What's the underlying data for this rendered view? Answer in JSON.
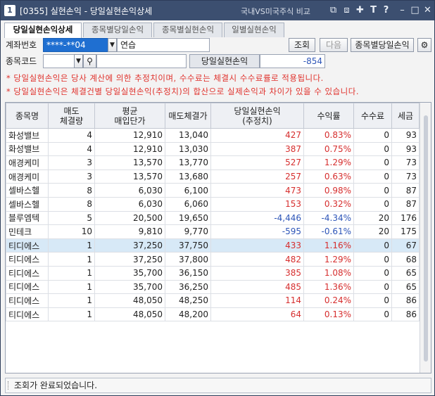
{
  "window": {
    "number": "1",
    "title": "[0355]  실현손익 - 당일실현손익상세",
    "right_text": "국내VS미국주식 비교",
    "icons": [
      "screen-number-icon",
      "window-copy-icon",
      "pin-icon",
      "text-size-icon",
      "help-icon",
      "minimize-icon",
      "maximize-icon",
      "close-icon"
    ]
  },
  "tabs": [
    {
      "label": "당일실현손익상세",
      "active": true
    },
    {
      "label": "종목별당일손익",
      "active": false
    },
    {
      "label": "종목별실현손익",
      "active": false
    },
    {
      "label": "일별실현손익",
      "active": false
    }
  ],
  "form": {
    "account_label": "계좌번호",
    "account_value": "****-**04",
    "account_name": "연습",
    "query_button": "조회",
    "next_button": "다음",
    "by_stock_button": "종목별당일손익",
    "stock_code_label": "종목코드",
    "stock_code_value": "",
    "stock_name_value": "",
    "daily_pl_label": "당일실현손익",
    "daily_pl_value": "-854"
  },
  "notices": [
    "* 당일실현손익은 당사 계산에 의한 추정치이며, 수수료는 체결시 수수료률로 적용됩니다.",
    "* 당일실현손익은 체결건별 당일실현손익(추정치)의 합산으로 실제손익과 차이가 있을 수 있습니다."
  ],
  "table": {
    "headers": [
      {
        "line1": "종목명",
        "line2": ""
      },
      {
        "line1": "매도",
        "line2": "체결량"
      },
      {
        "line1": "평균",
        "line2": "매입단가"
      },
      {
        "line1": "매도체결가",
        "line2": ""
      },
      {
        "line1": "당일실현손익",
        "line2": "(추정치)"
      },
      {
        "line1": "수익률",
        "line2": ""
      },
      {
        "line1": "수수료",
        "line2": ""
      },
      {
        "line1": "세금",
        "line2": ""
      }
    ],
    "rows": [
      {
        "name": "화성밸브",
        "qty": "4",
        "avg": "12,910",
        "sell": "13,040",
        "pl": "427",
        "rate": "0.83%",
        "fee": "0",
        "tax": "93",
        "sign": "pos"
      },
      {
        "name": "화성밸브",
        "qty": "4",
        "avg": "12,910",
        "sell": "13,030",
        "pl": "387",
        "rate": "0.75%",
        "fee": "0",
        "tax": "93",
        "sign": "pos"
      },
      {
        "name": "애경케미",
        "qty": "3",
        "avg": "13,570",
        "sell": "13,770",
        "pl": "527",
        "rate": "1.29%",
        "fee": "0",
        "tax": "73",
        "sign": "pos"
      },
      {
        "name": "애경케미",
        "qty": "3",
        "avg": "13,570",
        "sell": "13,680",
        "pl": "257",
        "rate": "0.63%",
        "fee": "0",
        "tax": "73",
        "sign": "pos"
      },
      {
        "name": "셀바스헬",
        "qty": "8",
        "avg": "6,030",
        "sell": "6,100",
        "pl": "473",
        "rate": "0.98%",
        "fee": "0",
        "tax": "87",
        "sign": "pos"
      },
      {
        "name": "셀바스헬",
        "qty": "8",
        "avg": "6,030",
        "sell": "6,060",
        "pl": "153",
        "rate": "0.32%",
        "fee": "0",
        "tax": "87",
        "sign": "pos"
      },
      {
        "name": "블루엠텍",
        "qty": "5",
        "avg": "20,500",
        "sell": "19,650",
        "pl": "-4,446",
        "rate": "-4.34%",
        "fee": "20",
        "tax": "176",
        "sign": "neg"
      },
      {
        "name": "민테크",
        "qty": "10",
        "avg": "9,810",
        "sell": "9,770",
        "pl": "-595",
        "rate": "-0.61%",
        "fee": "20",
        "tax": "175",
        "sign": "neg"
      },
      {
        "name": "티디에스",
        "qty": "1",
        "avg": "37,250",
        "sell": "37,750",
        "pl": "433",
        "rate": "1.16%",
        "fee": "0",
        "tax": "67",
        "sign": "pos",
        "selected": true
      },
      {
        "name": "티디에스",
        "qty": "1",
        "avg": "37,250",
        "sell": "37,800",
        "pl": "482",
        "rate": "1.29%",
        "fee": "0",
        "tax": "68",
        "sign": "pos"
      },
      {
        "name": "티디에스",
        "qty": "1",
        "avg": "35,700",
        "sell": "36,150",
        "pl": "385",
        "rate": "1.08%",
        "fee": "0",
        "tax": "65",
        "sign": "pos"
      },
      {
        "name": "티디에스",
        "qty": "1",
        "avg": "35,700",
        "sell": "36,250",
        "pl": "485",
        "rate": "1.36%",
        "fee": "0",
        "tax": "65",
        "sign": "pos"
      },
      {
        "name": "티디에스",
        "qty": "1",
        "avg": "48,050",
        "sell": "48,250",
        "pl": "114",
        "rate": "0.24%",
        "fee": "0",
        "tax": "86",
        "sign": "pos"
      },
      {
        "name": "티디에스",
        "qty": "1",
        "avg": "48,050",
        "sell": "48,200",
        "pl": "64",
        "rate": "0.13%",
        "fee": "0",
        "tax": "86",
        "sign": "pos"
      }
    ]
  },
  "status": {
    "text": "조회가 완료되었습니다."
  },
  "colors": {
    "title_bar": "#3c4f70",
    "positive": "#d62e2e",
    "negative": "#2d55b8",
    "selected_row": "#d7e9f7",
    "notice": "#e0312b"
  }
}
